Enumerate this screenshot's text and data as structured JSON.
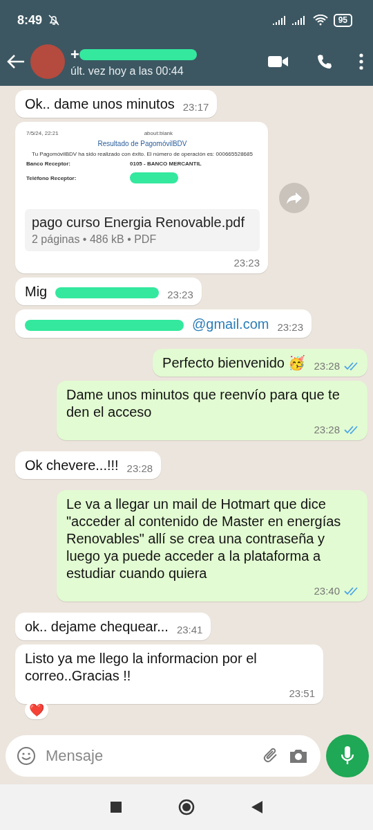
{
  "status_bar": {
    "time": "8:49",
    "battery": "95"
  },
  "header": {
    "name": "+",
    "name_redacted": true,
    "subtitle": "últ. vez hoy a las 00:44"
  },
  "messages": [
    {
      "kind": "text",
      "outgoing": false,
      "text": "Ok.. dame unos minutos",
      "time": "23:17"
    },
    {
      "kind": "document",
      "outgoing": false,
      "preview": {
        "date": "7/5/24, 22:21",
        "url": "about:blank",
        "title": "Resultado de PagomóvilBDV",
        "body": "Tu PagomóvilBDV ha sido realizado con éxito. El número de operación es: 000665528685",
        "rows": [
          {
            "label": "Banco Receptor:",
            "value": "0105 - BANCO MERCANTIL",
            "redacted": false
          },
          {
            "label": "Teléfono Receptor:",
            "value": "",
            "redacted": true
          }
        ]
      },
      "file_name": "pago curso Energia Renovable.pdf",
      "file_info": "2 páginas • 486 kB • PDF",
      "time": "23:23"
    },
    {
      "kind": "text",
      "outgoing": false,
      "text": "Mig",
      "redacted": true,
      "time": "23:23"
    },
    {
      "kind": "link",
      "outgoing": false,
      "text": "@gmail.com",
      "redacted": true,
      "time": "23:23"
    },
    {
      "kind": "text",
      "outgoing": true,
      "text": "Perfecto bienvenido 🥳",
      "time": "23:28",
      "read": true
    },
    {
      "kind": "text",
      "outgoing": true,
      "text": "Dame unos minutos que reenvío para que te den el acceso",
      "time": "23:28",
      "read": true
    },
    {
      "kind": "text",
      "outgoing": false,
      "text": "Ok chevere...!!!",
      "time": "23:28"
    },
    {
      "kind": "text",
      "outgoing": true,
      "text": "Le va a llegar un mail de Hotmart que dice \"acceder al contenido de Master en energías Renovables\" allí se crea una contraseña y luego ya puede acceder a la plataforma a estudiar cuando quiera",
      "time": "23:40",
      "read": true
    },
    {
      "kind": "text",
      "outgoing": false,
      "text": "ok.. dejame chequear...",
      "time": "23:41"
    },
    {
      "kind": "text",
      "outgoing": false,
      "text": "Listo ya me llego la informacion por el correo..Gracias !!",
      "time": "23:51",
      "reaction": "❤️"
    }
  ],
  "composer": {
    "placeholder": "Mensaje"
  }
}
